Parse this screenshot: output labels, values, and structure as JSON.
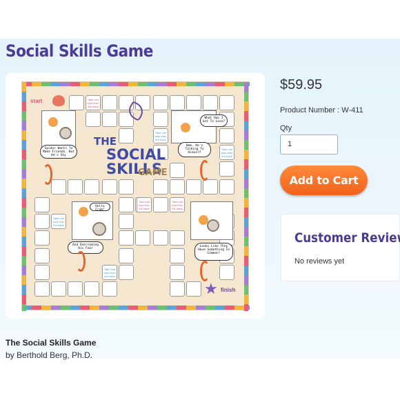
{
  "page": {
    "title": "Social Skills Game"
  },
  "product": {
    "price": "$59.95",
    "product_number": "Product Number : W-411",
    "qty_label": "Qty",
    "qty_value": "1",
    "add_to_cart": "Add to Cart"
  },
  "reviews": {
    "title": "Customer Reviews",
    "empty": "No reviews yet"
  },
  "book": {
    "title": "The Social Skills Game",
    "author": "by Berthold Berg, Ph.D."
  },
  "board": {
    "title_line1": "THE",
    "title_line2": "SOCIAL SKILLS",
    "title_line3": "GAME",
    "start": "start",
    "finish": "finish",
    "bubbles": [
      "Spider Wants To Make Friends. But He's Shy",
      "What Has I Got To Lose?",
      "Hmm, He's Talking To Himself",
      "Hello Crab!",
      "And Overcoming His Fear",
      "Looks Like They Have Something In Common!"
    ],
    "card_text": "Take one card from the bank"
  },
  "colors": {
    "accent": "#4b3a96",
    "cart": "#f2621c",
    "board": "#f5e6cf"
  }
}
